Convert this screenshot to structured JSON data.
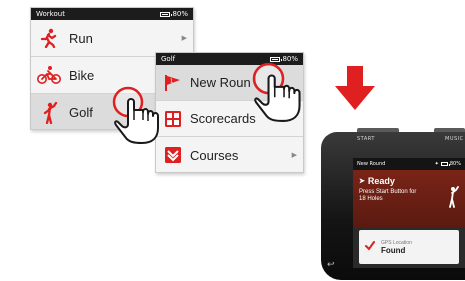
{
  "workout_menu": {
    "title": "Workout",
    "battery": "80%",
    "items": [
      {
        "label": "Run",
        "icon": "runner-icon",
        "has_submenu": true
      },
      {
        "label": "Bike",
        "icon": "cyclist-icon",
        "has_submenu": false
      },
      {
        "label": "Golf",
        "icon": "golfer-icon",
        "has_submenu": false,
        "selected": true
      }
    ]
  },
  "golf_menu": {
    "title": "Golf",
    "battery": "80%",
    "items": [
      {
        "label": "New Roun",
        "icon": "flag-icon",
        "has_submenu": false,
        "selected": true
      },
      {
        "label": "Scorecards",
        "icon": "scorecard-icon",
        "has_submenu": false
      },
      {
        "label": "Courses",
        "icon": "courses-icon",
        "has_submenu": true
      }
    ]
  },
  "device": {
    "start_label": "START",
    "music_label": "MUSIC",
    "screen": {
      "title": "New Round",
      "battery": "80%",
      "status_heading": "Ready",
      "status_message": "Press Start Button for 18 Holes",
      "gps_label": "GPS Location",
      "gps_value": "Found"
    }
  },
  "colors": {
    "accent_red": "#e02020",
    "menu_bg": "#f4f4f4",
    "statusbar_bg": "#1c1c1c",
    "screen_red": "#7a2417"
  }
}
